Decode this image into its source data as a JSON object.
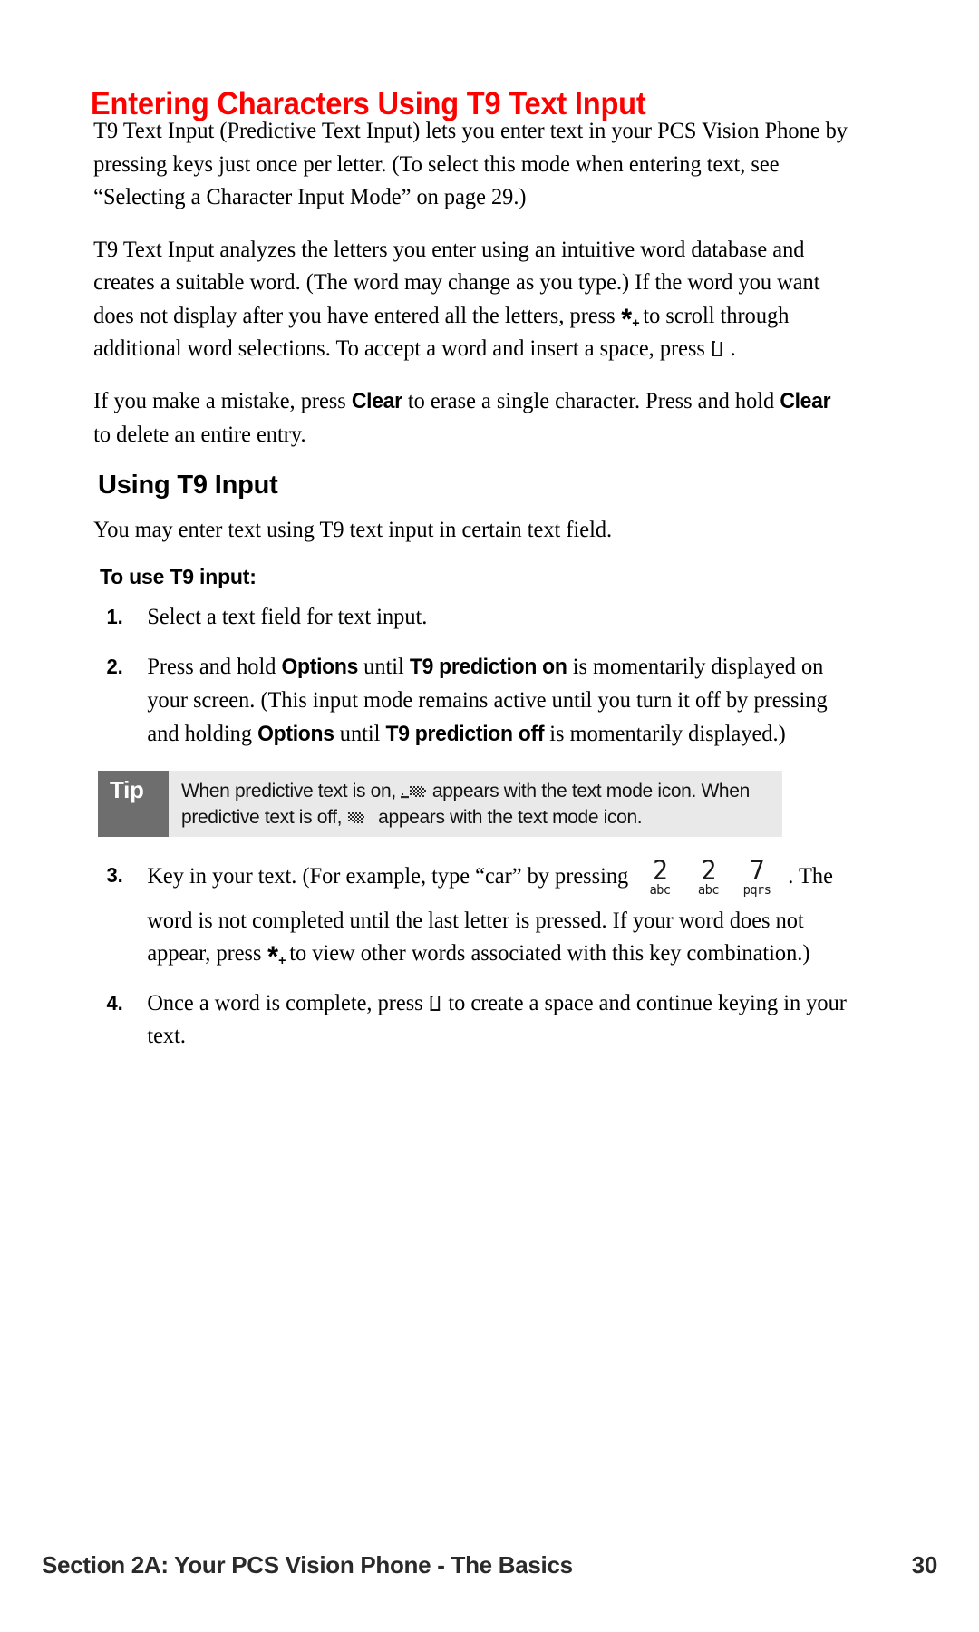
{
  "document": {
    "title": "Entering Characters Using T9 Text Input",
    "title_color": "#ff0000"
  },
  "paragraphs": {
    "p1_a": "T9 Text Input (Predictive Text Input) lets you enter text in your PCS Vision Phone by pressing keys just once per letter. (To select this mode when entering text, see “Selecting a Character Input Mode” on page 29.)",
    "p2_a": "T9 Text Input analyzes the letters you enter using an intuitive word database and creates a suitable word. (The word may change as you type.) If the word you want does not display after you have entered all the letters, press",
    "p2_b": "to scroll through additional word selections. To accept a word and insert a space, press",
    "p2_c": ".",
    "p3_a": "If you make a mistake, press",
    "p3_clear1": "Clear",
    "p3_b": "to erase a single character. Press and hold",
    "p3_clear2": "Clear",
    "p3_c": "to delete an entire entry."
  },
  "headings": {
    "using_t9_input": "Using T9 Input",
    "to_use_t9_input": "To use T9 input:"
  },
  "intro_line": "You may enter text using T9 text input in certain text field.",
  "steps": [
    {
      "num": "1.",
      "text_a": "Select a text field for text input."
    },
    {
      "num": "2.",
      "text_a": "Press and hold",
      "bold_1": "Options",
      "text_b": "until",
      "bold_2": "T9 prediction on",
      "text_c": "is momentarily displayed on your screen. (This input mode remains active until you turn it off by pressing and holding",
      "bold_3": "Options",
      "text_d": "until",
      "bold_4": "T9 prediction off",
      "text_e": "is momentarily displayed.)"
    },
    {
      "num": "3.",
      "text_a": "Key in your text. (For example, type “car” by pressing",
      "text_b": ". The word is not completed until the last letter is pressed. If your word does not appear, press",
      "text_c": "to view other words associated with this key combination.)"
    },
    {
      "num": "4.",
      "text_a": "Once a word is complete, press",
      "text_b": "to create a space and continue keying in your text."
    }
  ],
  "tip": {
    "label": "Tip",
    "text_a": "When predictive text is on,",
    "text_b": "appears with the text mode icon. When predictive text is off,",
    "text_c": "appears with the text mode icon.",
    "label_bg": "#6e6e6e",
    "body_bg": "#e9e9e9"
  },
  "keys": {
    "star": {
      "symbol": "*",
      "sub": "+",
      "name": "star-plus-key"
    },
    "space": {
      "name": "space-key"
    },
    "keypad_car": [
      {
        "digit": "2",
        "letters": "abc"
      },
      {
        "digit": "2",
        "letters": "abc"
      },
      {
        "digit": "7",
        "letters": "pqrs"
      }
    ]
  },
  "footer": {
    "left": "Section 2A: Your PCS Vision Phone - The Basics",
    "page_number": "30"
  }
}
